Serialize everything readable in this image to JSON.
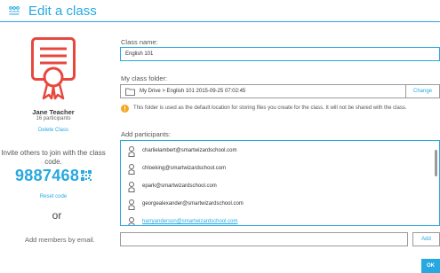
{
  "header": {
    "title": "Edit a class",
    "icon": "classes-grid-icon",
    "accent_color": "#27a8e0"
  },
  "left_panel": {
    "icon": "certificate-icon",
    "icon_color": "#e8473e",
    "teacher_name": "Jane Teacher",
    "participants_count": "16 participants",
    "delete_label": "Delete Class",
    "invite_text": "Invite others to join with the class code.",
    "class_code": "9887468",
    "reset_label": "Reset code",
    "or_label": "or",
    "add_members_label": "Add members by email."
  },
  "form": {
    "class_name_label": "Class name:",
    "class_name_value": "English 101",
    "folder_label": "My class folder:",
    "folder_path": "My Drive > English 101 2015-09-25 07:02:45",
    "change_label": "Change",
    "folder_note": "This folder is used as the default location for storing files you create for the class. It will not be shared with the class.",
    "participants_label": "Add participants:",
    "participants": [
      "charlielambert@smartwizardschool.com",
      "chloeking@smartwizardschool.com",
      "epark@smartwizardschool.com",
      "georgealexander@smartwizardschool.com",
      "harryanderson@smartwizardschool.com"
    ],
    "email_placeholder": "",
    "add_label": "Add",
    "ok_label": "OK"
  }
}
